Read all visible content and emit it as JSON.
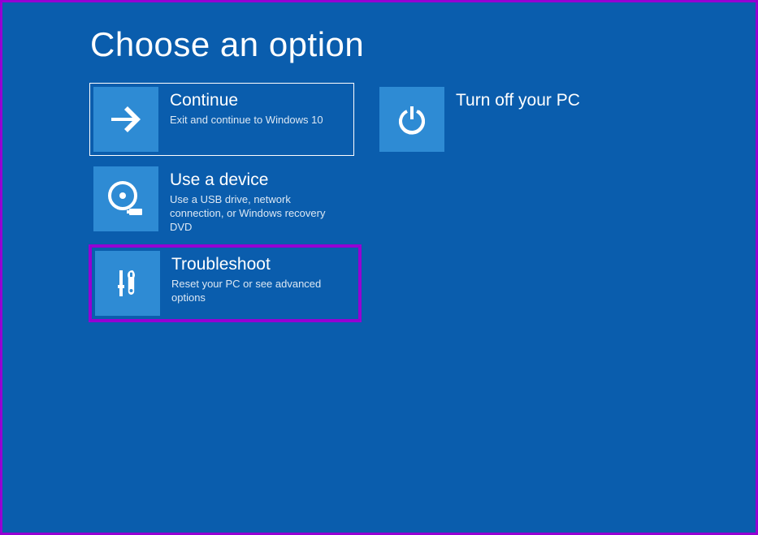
{
  "title": "Choose an option",
  "options": [
    {
      "title": "Continue",
      "desc": "Exit and continue to Windows 10"
    },
    {
      "title": "Use a device",
      "desc": "Use a USB drive, network connection, or Windows recovery DVD"
    },
    {
      "title": "Troubleshoot",
      "desc": "Reset your PC or see advanced options"
    },
    {
      "title": "Turn off your PC",
      "desc": ""
    }
  ]
}
